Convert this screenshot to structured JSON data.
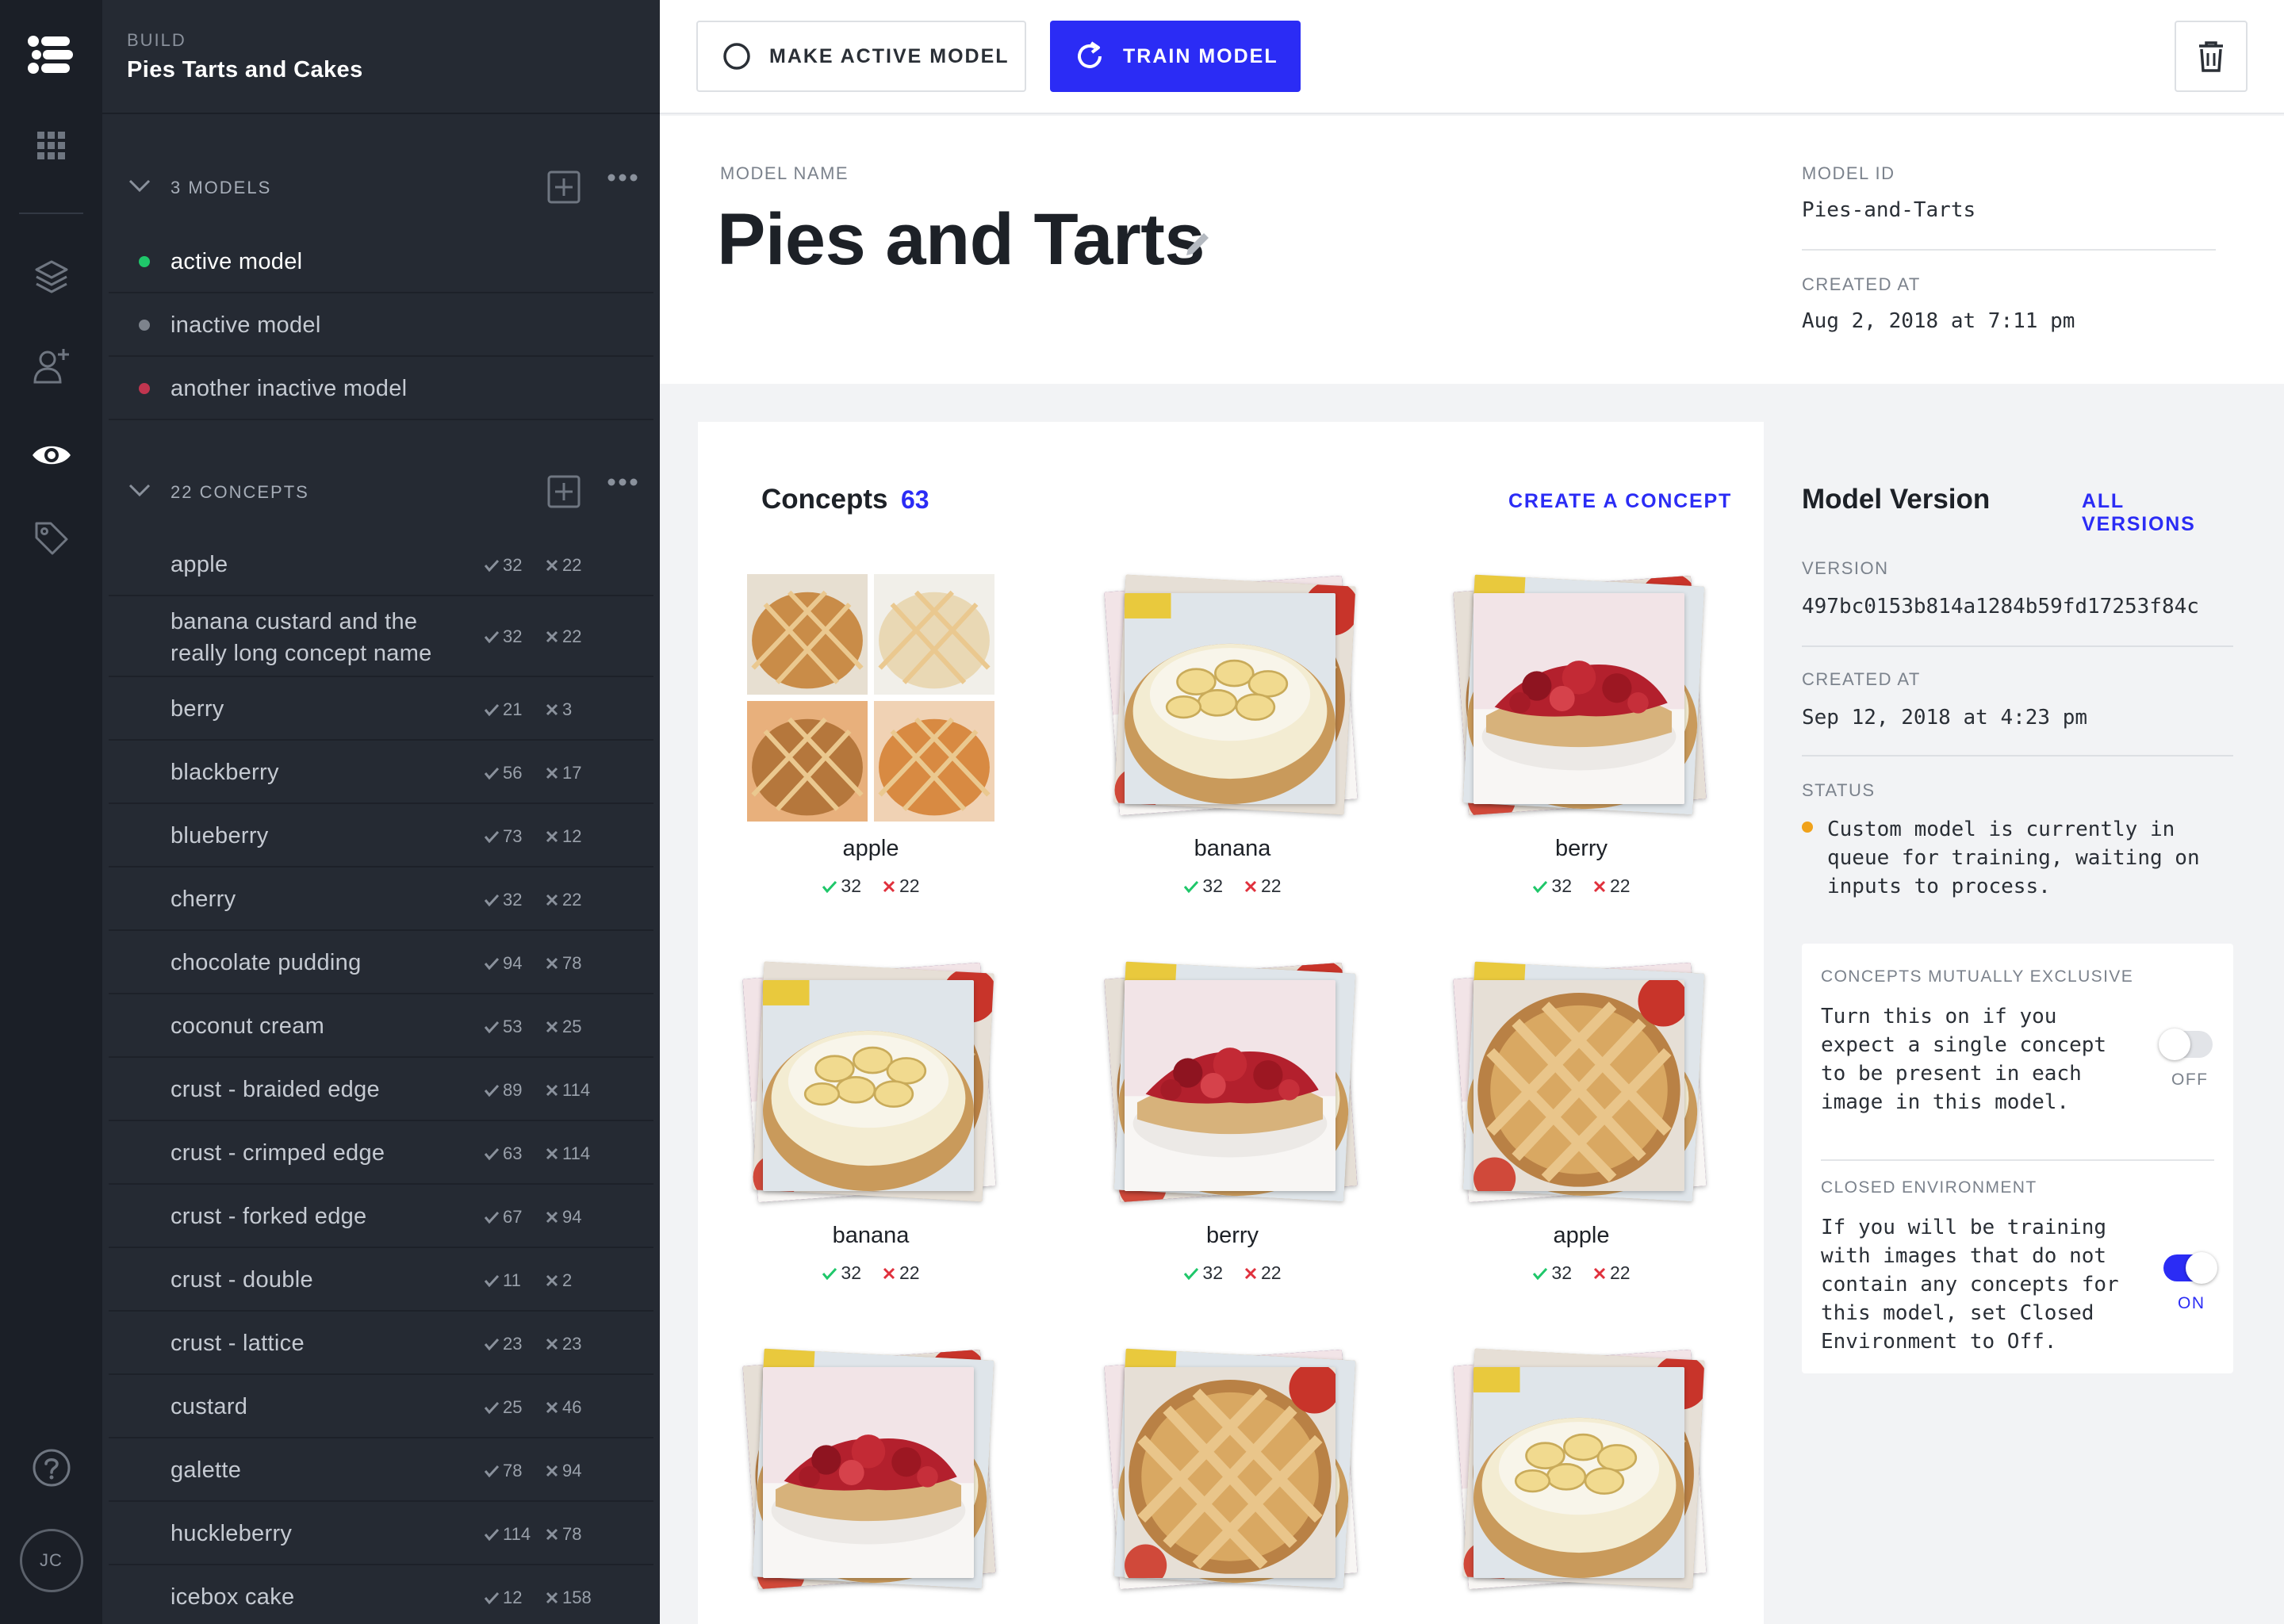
{
  "sidebar": {
    "build_label": "BUILD",
    "project_name": "Pies Tarts and Cakes",
    "models_header": "3 MODELS",
    "models": [
      {
        "label": "active model",
        "color": "#1fc76a"
      },
      {
        "label": "inactive model",
        "color": "#7d838c"
      },
      {
        "label": "another inactive model",
        "color": "#c0354f"
      }
    ],
    "concepts_header": "22 CONCEPTS",
    "concepts": [
      {
        "label": "apple",
        "pos": "32",
        "neg": "22"
      },
      {
        "label": "banana custard and the really long concept name",
        "pos": "32",
        "neg": "22"
      },
      {
        "label": "berry",
        "pos": "21",
        "neg": "3"
      },
      {
        "label": "blackberry",
        "pos": "56",
        "neg": "17"
      },
      {
        "label": "blueberry",
        "pos": "73",
        "neg": "12"
      },
      {
        "label": "cherry",
        "pos": "32",
        "neg": "22"
      },
      {
        "label": "chocolate pudding",
        "pos": "94",
        "neg": "78"
      },
      {
        "label": "coconut cream",
        "pos": "53",
        "neg": "25"
      },
      {
        "label": "crust - braided edge",
        "pos": "89",
        "neg": "114"
      },
      {
        "label": "crust - crimped edge",
        "pos": "63",
        "neg": "114"
      },
      {
        "label": "crust - forked edge",
        "pos": "67",
        "neg": "94"
      },
      {
        "label": "crust - double",
        "pos": "11",
        "neg": "2"
      },
      {
        "label": "crust - lattice",
        "pos": "23",
        "neg": "23"
      },
      {
        "label": "custard",
        "pos": "25",
        "neg": "46"
      },
      {
        "label": "galette",
        "pos": "78",
        "neg": "94"
      },
      {
        "label": "huckleberry",
        "pos": "114",
        "neg": "78"
      },
      {
        "label": "icebox cake",
        "pos": "12",
        "neg": "158"
      }
    ]
  },
  "rail": {
    "avatar_initials": "JC",
    "icons": [
      "logo-icon",
      "apps-grid-icon",
      "layers-icon",
      "add-user-icon",
      "eye-icon",
      "tag-icon",
      "help-icon"
    ]
  },
  "toolbar": {
    "make_active_label": "MAKE ACTIVE MODEL",
    "train_label": "TRAIN MODEL",
    "accent": "#2b2cf5"
  },
  "model": {
    "name_label": "MODEL NAME",
    "name": "Pies and Tarts",
    "id_label": "MODEL ID",
    "id": "Pies-and-Tarts",
    "created_label": "CREATED AT",
    "created": "Aug 2, 2018 at 7:11 pm"
  },
  "concepts_panel": {
    "title": "Concepts",
    "count": "63",
    "create_label": "CREATE A CONCEPT",
    "tiles": [
      {
        "label": "apple",
        "pos": "32",
        "neg": "22",
        "kind": "grid"
      },
      {
        "label": "banana",
        "pos": "32",
        "neg": "22",
        "kind": "banana"
      },
      {
        "label": "berry",
        "pos": "32",
        "neg": "22",
        "kind": "berry"
      },
      {
        "label": "banana",
        "pos": "32",
        "neg": "22",
        "kind": "banana"
      },
      {
        "label": "berry",
        "pos": "32",
        "neg": "22",
        "kind": "berry"
      },
      {
        "label": "apple",
        "pos": "32",
        "neg": "22",
        "kind": "apple"
      },
      {
        "label": "",
        "pos": "",
        "neg": "",
        "kind": "berry"
      },
      {
        "label": "",
        "pos": "",
        "neg": "",
        "kind": "apple"
      },
      {
        "label": "",
        "pos": "",
        "neg": "",
        "kind": "banana"
      }
    ]
  },
  "version_panel": {
    "title": "Model Version",
    "all_versions_label": "ALL VERSIONS",
    "version_label": "VERSION",
    "version": "497bc0153b814a1284b59fd17253f84c",
    "created_label": "CREATED AT",
    "created": "Sep 12, 2018 at 4:23 pm",
    "status_label": "STATUS",
    "status": "Custom model is currently in queue for training, waiting on inputs to process.",
    "status_color": "#f0a21b",
    "settings": {
      "exclusive_label": "CONCEPTS MUTUALLY EXCLUSIVE",
      "exclusive_text": "Turn this on if you expect a single concept to be present in each image in this model.",
      "exclusive_state": "OFF",
      "closed_label": "CLOSED ENVIRONMENT",
      "closed_text": "If you will be training with images that do not contain any concepts for this model, set Closed Environment to Off.",
      "closed_state": "ON"
    }
  }
}
